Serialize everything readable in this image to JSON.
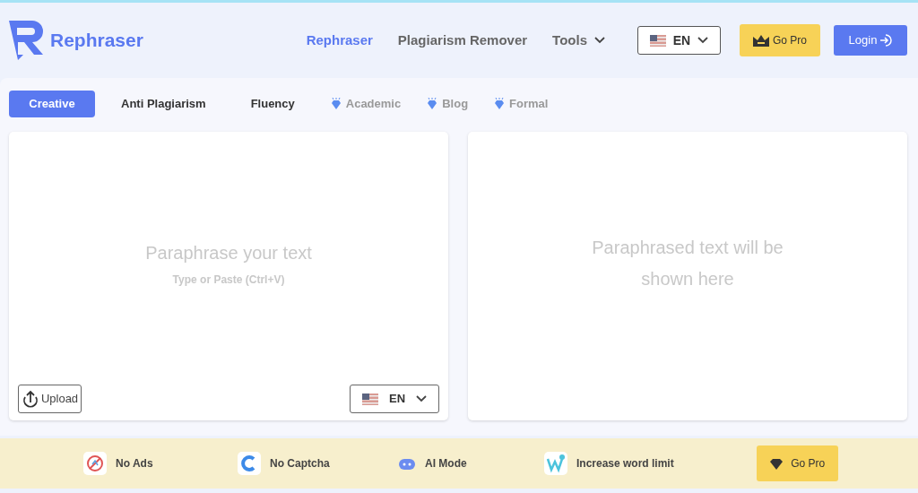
{
  "brand": {
    "name": "Rephraser"
  },
  "nav": [
    {
      "label": "Rephraser",
      "selected": true,
      "kind": "link"
    },
    {
      "label": "Plagiarism Remover",
      "selected": false,
      "kind": "link"
    },
    {
      "label": "Tools",
      "selected": false,
      "kind": "dropdown"
    }
  ],
  "language": {
    "label": "EN"
  },
  "go_pro": {
    "label": "Go Pro"
  },
  "login": {
    "label": "Login"
  },
  "modes": [
    {
      "label": "Creative",
      "selected": true,
      "premium": false
    },
    {
      "label": "Anti Plagiarism",
      "selected": false,
      "premium": false
    },
    {
      "label": "Fluency",
      "selected": false,
      "premium": false
    },
    {
      "label": "Academic",
      "selected": false,
      "premium": true
    },
    {
      "label": "Blog",
      "selected": false,
      "premium": true
    },
    {
      "label": "Formal",
      "selected": false,
      "premium": true
    }
  ],
  "input": {
    "placeholder": "Paraphrase your text",
    "hint": "Type or Paste (Ctrl+V)",
    "upload": "Upload",
    "language": "EN"
  },
  "output": {
    "placeholder": "Paraphrased text will be shown here"
  },
  "features": [
    {
      "kind": "no-ads",
      "label": "No Ads"
    },
    {
      "kind": "no-captcha",
      "label": "No Captcha"
    },
    {
      "kind": "ai-mode",
      "label": "AI Mode"
    },
    {
      "kind": "word-limit",
      "label": "Increase word limit"
    }
  ],
  "banner_button": {
    "label": "Go Pro"
  }
}
